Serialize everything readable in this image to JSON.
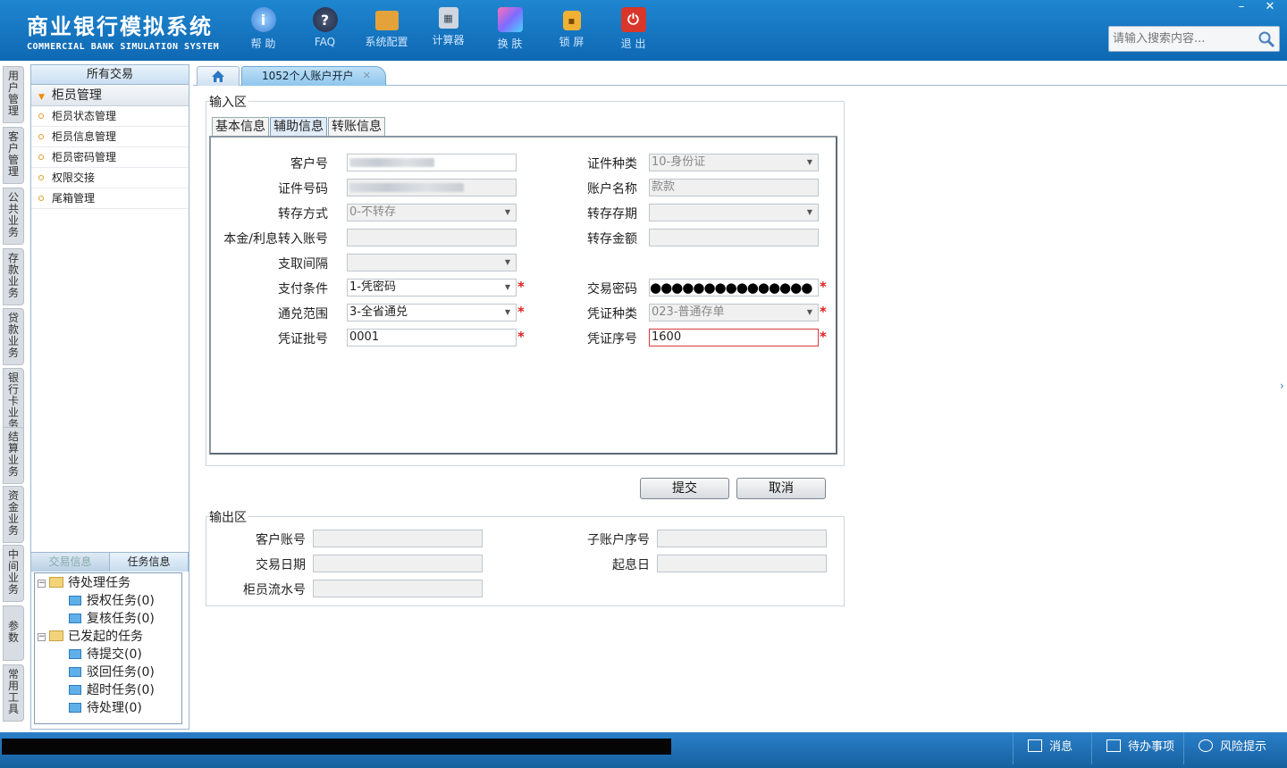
{
  "header": {
    "title_cn": "商业银行模拟系统",
    "title_en": "COMMERCIAL BANK SIMULATION SYSTEM",
    "toolbar": [
      {
        "label": "帮 助",
        "icon": "help-icon"
      },
      {
        "label": "FAQ",
        "icon": "faq-icon"
      },
      {
        "label": "系统配置",
        "icon": "settings-icon"
      },
      {
        "label": "计算器",
        "icon": "calculator-icon"
      },
      {
        "label": "换 肤",
        "icon": "skin-icon"
      },
      {
        "label": "锁 屏",
        "icon": "lock-icon"
      },
      {
        "label": "退 出",
        "icon": "exit-icon"
      }
    ],
    "search_placeholder": "请输入搜索内容...",
    "window_controls": {
      "minimize": "–",
      "close": "✕"
    }
  },
  "vnav": [
    "用户管理",
    "客户管理",
    "公共业务",
    "存款业务",
    "贷款业务",
    "银行卡业务",
    "结算业务",
    "资金业务",
    "中间业务",
    "参数",
    "常用工具"
  ],
  "side_menu": {
    "header": "所有交易",
    "group": "柜员管理",
    "items": [
      "柜员状态管理",
      "柜员信息管理",
      "柜员密码管理",
      "权限交接",
      "尾箱管理"
    ]
  },
  "task_panel": {
    "tabs": [
      "交易信息",
      "任务信息"
    ],
    "tree": [
      {
        "label": "待处理任务",
        "level": 0
      },
      {
        "label": "授权任务(0)",
        "level": 1
      },
      {
        "label": "复核任务(0)",
        "level": 1
      },
      {
        "label": "已发起的任务",
        "level": 0
      },
      {
        "label": "待提交(0)",
        "level": 1
      },
      {
        "label": "驳回任务(0)",
        "level": 1
      },
      {
        "label": "超时任务(0)",
        "level": 1
      },
      {
        "label": "待处理(0)",
        "level": 1
      }
    ]
  },
  "tabs": {
    "active": "1052个人账户开户"
  },
  "input_area": {
    "legend": "输入区",
    "subtabs": [
      "基本信息",
      "辅助信息",
      "转账信息"
    ],
    "fields": {
      "customer_no": {
        "label": "客户号",
        "value": ""
      },
      "id_type": {
        "label": "证件种类",
        "value": "10-身份证"
      },
      "id_no": {
        "label": "证件号码",
        "value": ""
      },
      "account_name": {
        "label": "账户名称",
        "value": "款款"
      },
      "deposit_mode": {
        "label": "转存方式",
        "value": "0-不转存"
      },
      "deposit_term": {
        "label": "转存存期",
        "value": ""
      },
      "interest_account": {
        "label": "本金/利息转入账号",
        "value": ""
      },
      "deposit_amount": {
        "label": "转存金额",
        "value": ""
      },
      "withdraw_interval": {
        "label": "支取间隔",
        "value": ""
      },
      "pay_condition": {
        "label": "支付条件",
        "value": "1-凭密码"
      },
      "trade_password": {
        "label": "交易密码",
        "value": "●●●●●●●●●●●●●●●"
      },
      "exchange_range": {
        "label": "通兑范围",
        "value": "3-全省通兑"
      },
      "voucher_type": {
        "label": "凭证种类",
        "value": "023-普通存单"
      },
      "voucher_batch": {
        "label": "凭证批号",
        "value": "0001"
      },
      "voucher_seq": {
        "label": "凭证序号",
        "value": "1600"
      }
    }
  },
  "buttons": {
    "submit": "提交",
    "cancel": "取消"
  },
  "output_area": {
    "legend": "输出区",
    "fields": {
      "customer_account": "客户账号",
      "sub_account": "子账户序号",
      "trade_date": "交易日期",
      "value_date": "起息日",
      "teller_serial": "柜员流水号"
    }
  },
  "statusbar": {
    "message": "消息",
    "todo": "待办事项",
    "risk": "风险提示"
  }
}
